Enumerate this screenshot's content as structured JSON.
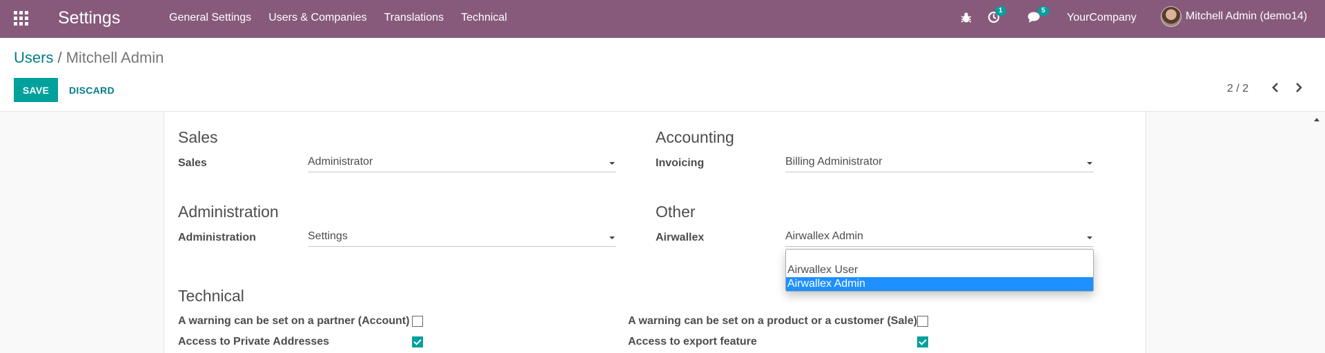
{
  "navbar": {
    "app_title": "Settings",
    "menu": [
      "General Settings",
      "Users & Companies",
      "Translations",
      "Technical"
    ],
    "activity_count": "1",
    "messages_count": "5",
    "company": "YourCompany",
    "user": "Mitchell Admin (demo14)"
  },
  "breadcrumb": {
    "parent": "Users",
    "separator": "/",
    "current": "Mitchell Admin"
  },
  "actions": {
    "save": "SAVE",
    "discard": "DISCARD"
  },
  "pager": {
    "value": "2 / 2"
  },
  "groups": {
    "sales": {
      "title": "Sales",
      "label": "Sales",
      "value": "Administrator"
    },
    "accounting": {
      "title": "Accounting",
      "label": "Invoicing",
      "value": "Billing Administrator"
    },
    "administration": {
      "title": "Administration",
      "label": "Administration",
      "value": "Settings"
    },
    "other": {
      "title": "Other",
      "label": "Airwallex",
      "value": "Airwallex Admin"
    }
  },
  "dropdown": {
    "options": [
      "",
      "Airwallex User",
      "Airwallex Admin"
    ],
    "selected": "Airwallex Admin"
  },
  "technical": {
    "title": "Technical",
    "checks": [
      {
        "label": "A warning can be set on a partner (Account)",
        "checked": false
      },
      {
        "label": "A warning can be set on a product or a customer (Sale)",
        "checked": false
      },
      {
        "label": "Access to Private Addresses",
        "checked": true
      },
      {
        "label": "Access to export feature",
        "checked": true
      }
    ]
  },
  "colors": {
    "navbar": "#875a7b",
    "primary": "#00a09d",
    "link": "#017e84",
    "selected_option": "#1e90ff"
  }
}
